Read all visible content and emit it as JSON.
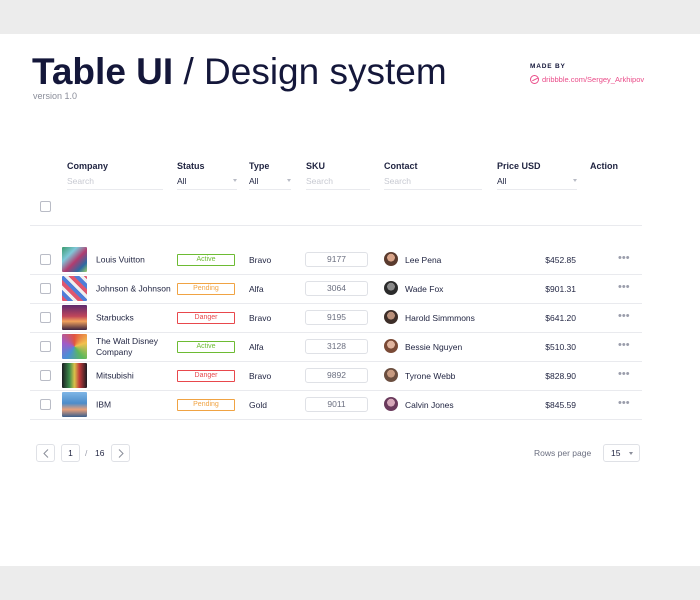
{
  "header": {
    "title_strong": "Table UI",
    "title_sep": "/",
    "title_light": "Design system",
    "version": "version 1.0",
    "made_by_label": "MADE BY",
    "made_by_link": "dribbble.com/Sergey_Arkhipov"
  },
  "table": {
    "columns": {
      "company": "Company",
      "status": "Status",
      "type": "Type",
      "sku": "SKU",
      "contact": "Contact",
      "price": "Price USD",
      "action": "Action"
    },
    "filters": {
      "company_placeholder": "Search",
      "status_value": "All",
      "type_value": "All",
      "sku_placeholder": "Search",
      "contact_placeholder": "Search",
      "price_value": "All"
    },
    "rows": [
      {
        "company": "Louis Vuitton",
        "status": "Active",
        "type": "Bravo",
        "sku": "9177",
        "contact": "Lee Pena",
        "price": "$452.85",
        "action": "•••"
      },
      {
        "company": "Johnson & Johnson",
        "status": "Pending",
        "type": "Alfa",
        "sku": "3064",
        "contact": "Wade Fox",
        "price": "$901.31",
        "action": "•••"
      },
      {
        "company": "Starbucks",
        "status": "Danger",
        "type": "Bravo",
        "sku": "9195",
        "contact": "Harold Simmmons",
        "price": "$641.20",
        "action": "•••"
      },
      {
        "company": "The Walt Disney Company",
        "status": "Active",
        "type": "Alfa",
        "sku": "3128",
        "contact": "Bessie Nguyen",
        "price": "$510.30",
        "action": "•••"
      },
      {
        "company": "Mitsubishi",
        "status": "Danger",
        "type": "Bravo",
        "sku": "9892",
        "contact": "Tyrone Webb",
        "price": "$828.90",
        "action": "•••"
      },
      {
        "company": "IBM",
        "status": "Pending",
        "type": "Gold",
        "sku": "9011",
        "contact": "Calvin Jones",
        "price": "$845.59",
        "action": "•••"
      }
    ]
  },
  "pagination": {
    "current_page": "1",
    "separator": "/",
    "total_pages": "16",
    "rows_per_page_label": "Rows per page",
    "rows_per_page_value": "15"
  },
  "colors": {
    "active": "#6dbb33",
    "pending": "#f0a343",
    "danger": "#e8484c",
    "brand_link": "#ea4c89",
    "title": "#14173a"
  },
  "icons": {
    "prev": "chevron-left-icon",
    "next": "chevron-right-icon",
    "dribbble": "dribbble-icon",
    "action": "more-horizontal-icon"
  }
}
